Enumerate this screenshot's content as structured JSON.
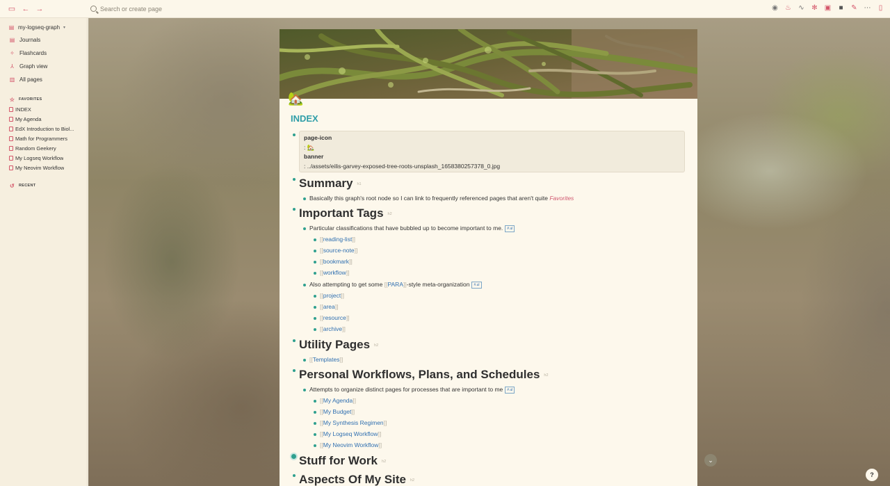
{
  "topbar": {
    "search_placeholder": "Search or create page",
    "left_icons": [
      "sidebar-toggle-icon",
      "back-arrow-icon",
      "forward-arrow-icon"
    ],
    "right_icons": [
      "eye-icon",
      "flame-icon",
      "chart-icon",
      "puzzle-icon",
      "calendar-icon",
      "bookmark-icon",
      "plugin-icon",
      "more-icon",
      "right-sidebar-icon"
    ]
  },
  "sidebar": {
    "graph_name": "my-logseq-graph",
    "nav": [
      {
        "label": "Journals",
        "icon": "calendar-icon"
      },
      {
        "label": "Flashcards",
        "icon": "cards-icon"
      },
      {
        "label": "Graph view",
        "icon": "graph-icon"
      },
      {
        "label": "All pages",
        "icon": "pages-icon"
      }
    ],
    "favorites_title": "FAVORITES",
    "favorites": [
      "INDEX",
      "My Agenda",
      "EdX Introduction to Biol...",
      "Math for Programmers",
      "Random Geekery",
      "My Logseq Workflow",
      "My Neovim Workflow"
    ],
    "recent_title": "RECENT"
  },
  "page": {
    "icon": "🏡",
    "title": "INDEX",
    "props": {
      "icon_key": "page-icon",
      "icon_val": ": 🏡",
      "banner_key": "banner",
      "banner_val": ": ../assets/eilis-garvey-exposed-tree-roots-unsplash_1658380257378_0.jpg"
    },
    "summary": {
      "heading": "Summary",
      "heading_tag": "h1",
      "text": "Basically this graph's root node so I can link to frequently referenced pages that aren't quite ",
      "italic": "Favorites"
    },
    "important_tags": {
      "heading": "Important Tags",
      "heading_tag": "h2",
      "intro": "Particular classifications that have bubbled up to become important to me.",
      "intro_tag": "#.ul",
      "tags": [
        "reading-list",
        "source-note",
        "bookmark",
        "workflow"
      ],
      "para_before": "Also attempting to get some ",
      "para_link": "PARA",
      "para_after": "-style meta-organization",
      "para_tag": "#.ul",
      "para_items": [
        "project",
        "area",
        "resource",
        "archive"
      ]
    },
    "utility": {
      "heading": "Utility Pages",
      "heading_tag": "h2",
      "link": "Templates"
    },
    "personal": {
      "heading": "Personal Workflows, Plans, and Schedules",
      "heading_tag": "h2",
      "intro": "Attempts to organize distinct pages for processes that are important to me",
      "intro_tag": "#.ul",
      "items": [
        "My Agenda",
        "My Budget",
        "My Synthesis Regimen",
        "My Logseq Workflow",
        "My Neovim Workflow"
      ]
    },
    "work": {
      "heading": "Stuff for Work",
      "heading_tag": "h2"
    },
    "site": {
      "heading": "Aspects Of My Site",
      "heading_tag": "h2"
    }
  },
  "buttons": {
    "scroll_down": "⌄",
    "help": "?"
  },
  "colors": {
    "accent": "#d4566a",
    "title": "#2f9ea8",
    "bullet": "#2fa08f",
    "link": "#2f6fb0"
  }
}
